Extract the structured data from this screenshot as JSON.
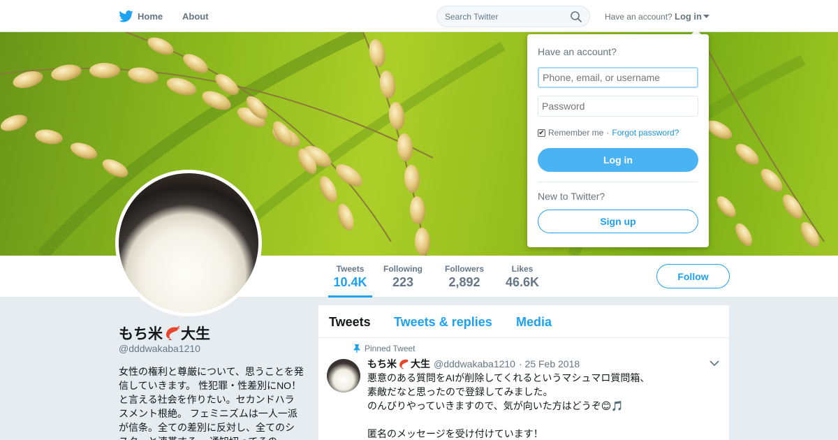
{
  "nav": {
    "home_label": "Home",
    "about_label": "About",
    "search_placeholder": "Search Twitter",
    "account_question": "Have an account?",
    "login_label": "Log in"
  },
  "profile": {
    "name_part1": "もち米",
    "name_part2": "大生",
    "handle": "@dddwakaba1210",
    "bio": "女性の権利と尊厳について、思うことを発信していきます。 性犯罪・性差別にNO！と言える社会を作りたい。セカンドハラスメント根絶。 フェミニズムは一人一派が信条。全ての差別に反対し、全てのシスターと連帯する。 通知切ってるの",
    "follow_label": "Follow"
  },
  "stats": [
    {
      "label": "Tweets",
      "value": "10.4K"
    },
    {
      "label": "Following",
      "value": "223"
    },
    {
      "label": "Followers",
      "value": "2,892"
    },
    {
      "label": "Likes",
      "value": "46.6K"
    }
  ],
  "tabs": [
    "Tweets",
    "Tweets & replies",
    "Media"
  ],
  "tweet": {
    "pinned_label": "Pinned Tweet",
    "author_part1": "もち米",
    "author_part2": "大生",
    "handle": "@dddwakaba1210",
    "date": "· 25 Feb 2018",
    "lines": [
      "悪意のある質問をAIが削除してくれるというマシュマロ質問箱、",
      "素敵だなと思ったので登録してみました。",
      "のんびりやっていきますので、気が向いた方はどうぞ😊🎵",
      "",
      "匿名のメッセージを受け付けています！"
    ]
  },
  "login": {
    "title": "Have an account?",
    "username_placeholder": "Phone, email, or username",
    "password_placeholder": "Password",
    "remember_label": "Remember me",
    "separator": "·",
    "forgot_label": "Forgot password?",
    "login_button": "Log in",
    "new_label": "New to Twitter?",
    "signup_button": "Sign up"
  },
  "colors": {
    "accent": "#1da1f2",
    "login_button": "#4ab3f4"
  }
}
